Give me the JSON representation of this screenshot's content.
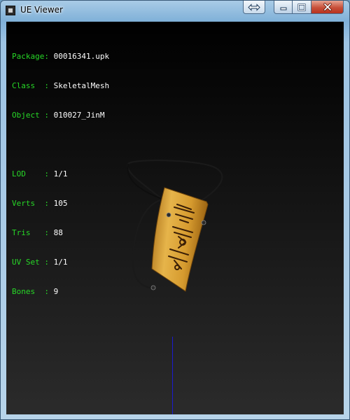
{
  "window": {
    "title": "UE Viewer"
  },
  "info_panel": {
    "rows": [
      {
        "label": "Package:",
        "value": "00016341.upk"
      },
      {
        "label": "Class  :",
        "value": "SkeletalMesh"
      },
      {
        "label": "Object :",
        "value": "010027_JinM"
      }
    ],
    "stats": [
      {
        "label": "LOD    :",
        "value": "1/1"
      },
      {
        "label": "Verts  :",
        "value": "105"
      },
      {
        "label": "Tris   :",
        "value": "88"
      },
      {
        "label": "UV Set :",
        "value": "1/1"
      },
      {
        "label": "Bones  :",
        "value": "9"
      }
    ]
  },
  "colors": {
    "label": "#27d827",
    "value": "#ffffff",
    "axis": "#1b1bd0",
    "plaque": "#d9a23a"
  }
}
